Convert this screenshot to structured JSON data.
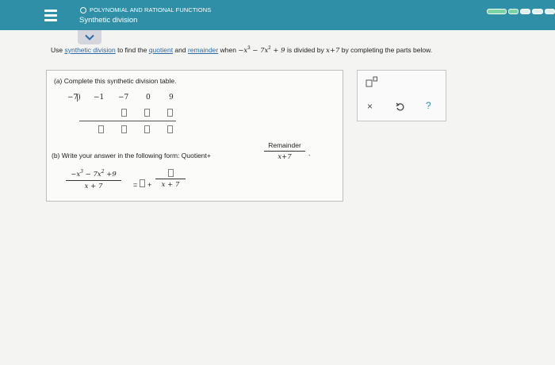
{
  "header": {
    "topic": "POLYNOMIAL AND RATIONAL FUNCTIONS",
    "title": "Synthetic division",
    "progress_segments": [
      1,
      1,
      0,
      0,
      0
    ]
  },
  "question": {
    "t1": "Use ",
    "link1": "synthetic division",
    "t2": " to find the ",
    "link2": "quotient",
    "t3": " and ",
    "link3": "remainder",
    "t4": " when ",
    "p1": "−x",
    "e1": "3",
    "p2": " − 7x",
    "e2": "2",
    "p3": " + 9",
    "t5": " is divided by ",
    "d1": "x+7",
    "t6": " by completing the parts below."
  },
  "part_a": {
    "label": "(a) Complete this synthetic division table.",
    "divisor": "−7)",
    "coefficients": [
      "−1",
      "−7",
      "0",
      "9"
    ]
  },
  "part_b": {
    "label": "(b) Write your answer in the following form: Quotient+",
    "remainder_word": "Remainder",
    "divisor": "x+7",
    "period": ".",
    "num_p1": "−x",
    "num_e1": "3",
    "num_p2": " − 7x",
    "num_e2": "2",
    "num_p3": " +9",
    "den": "x + 7",
    "equals": "=",
    "plus": "+",
    "den2": "x + 7"
  },
  "tools": {
    "close": "×",
    "help": "?"
  },
  "colors": {
    "header_bg": "#2f8fa6",
    "link": "#2c6aa6",
    "progress_fill": "#7bd3a6"
  }
}
